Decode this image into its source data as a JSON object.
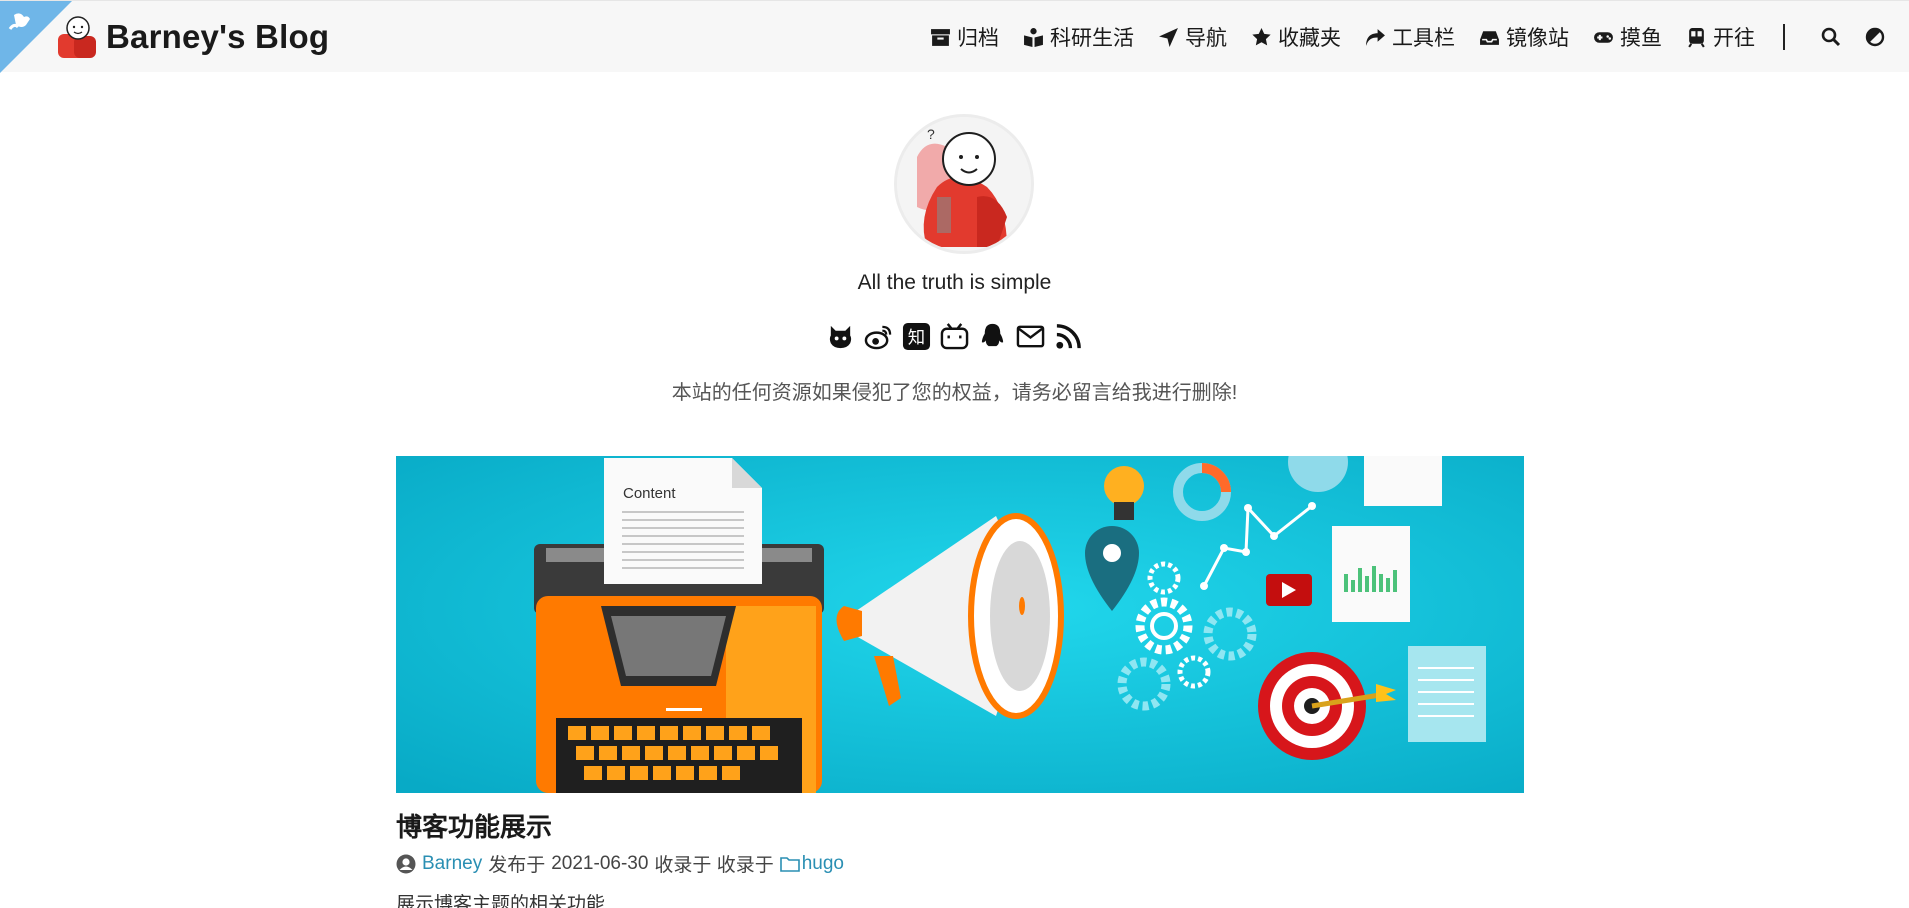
{
  "site": {
    "title": "Barney's Blog"
  },
  "nav": {
    "items": [
      {
        "label": "归档",
        "icon": "archive-icon"
      },
      {
        "label": "科研生活",
        "icon": "book-reader-icon"
      },
      {
        "label": "导航",
        "icon": "location-arrow-icon"
      },
      {
        "label": "收藏夹",
        "icon": "star-icon"
      },
      {
        "label": "工具栏",
        "icon": "share-arrow-icon"
      },
      {
        "label": "镜像站",
        "icon": "inbox-icon"
      },
      {
        "label": "摸鱼",
        "icon": "gamepad-icon"
      },
      {
        "label": "开往",
        "icon": "subway-icon"
      }
    ],
    "search_icon": "search-icon",
    "theme_icon": "contrast-icon"
  },
  "profile": {
    "subtitle": "All the truth is simple",
    "socials": [
      "github-icon",
      "weibo-icon",
      "zhihu-icon",
      "bilibili-icon",
      "qq-icon",
      "email-icon",
      "rss-icon"
    ],
    "zhihu_glyph": "知",
    "notice": "本站的任何资源如果侵犯了您的权益，请务必留言给我进行删除!"
  },
  "post": {
    "cover_caption": "Content",
    "title": "博客功能展示",
    "author": "Barney",
    "published_prefix": "发布于",
    "date": "2021-06-30",
    "collected_prefix": "收录于 收录于",
    "category": "hugo",
    "summary": "展示博客主题的相关功能"
  },
  "colors": {
    "accent": "#2a8fb3",
    "header_bg": "#f7f7f7",
    "cover_bg": "#19c6df",
    "ribbon": "#6fb6e8"
  }
}
